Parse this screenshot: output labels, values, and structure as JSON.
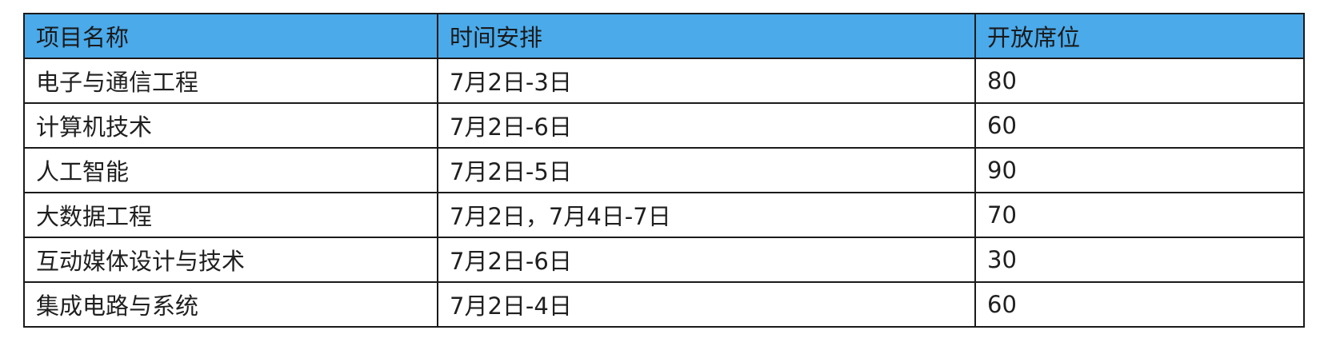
{
  "table": {
    "columns": [
      "项目名称",
      "时间安排",
      "开放席位"
    ],
    "rows": [
      {
        "name": "电子与通信工程",
        "time": "7月2日-3日",
        "seats": "80"
      },
      {
        "name": "计算机技术",
        "time": "7月2日-6日",
        "seats": "60"
      },
      {
        "name": "人工智能",
        "time": "7月2日-5日",
        "seats": "90"
      },
      {
        "name": "大数据工程",
        "time": "7月2日，7月4日-7日",
        "seats": "70"
      },
      {
        "name": "互动媒体设计与技术",
        "time": "7月2日-6日",
        "seats": "30"
      },
      {
        "name": "集成电路与系统",
        "time": "7月2日-4日",
        "seats": "60"
      }
    ]
  },
  "colors": {
    "header_background": "#4aaaea",
    "border": "#1a1a1a"
  }
}
